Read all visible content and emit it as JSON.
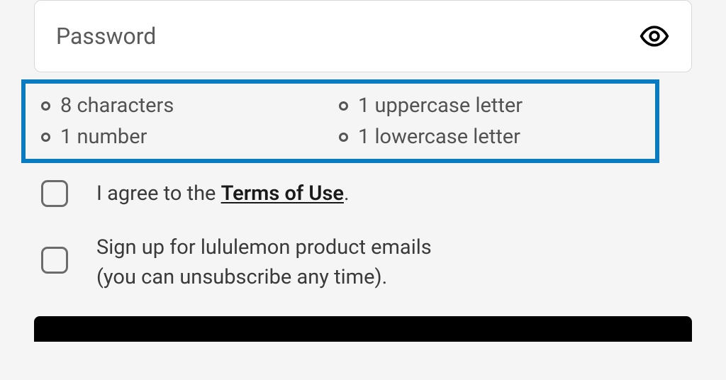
{
  "password": {
    "placeholder": "Password"
  },
  "requirements": {
    "r0": "8 characters",
    "r1": "1 uppercase letter",
    "r2": "1 number",
    "r3": "1 lowercase letter"
  },
  "terms": {
    "prefix": "I agree to the ",
    "link": "Terms of Use",
    "suffix": "."
  },
  "newsletter": {
    "line1": "Sign up for lululemon product emails",
    "line2": "(you can unsubscribe any time)."
  }
}
